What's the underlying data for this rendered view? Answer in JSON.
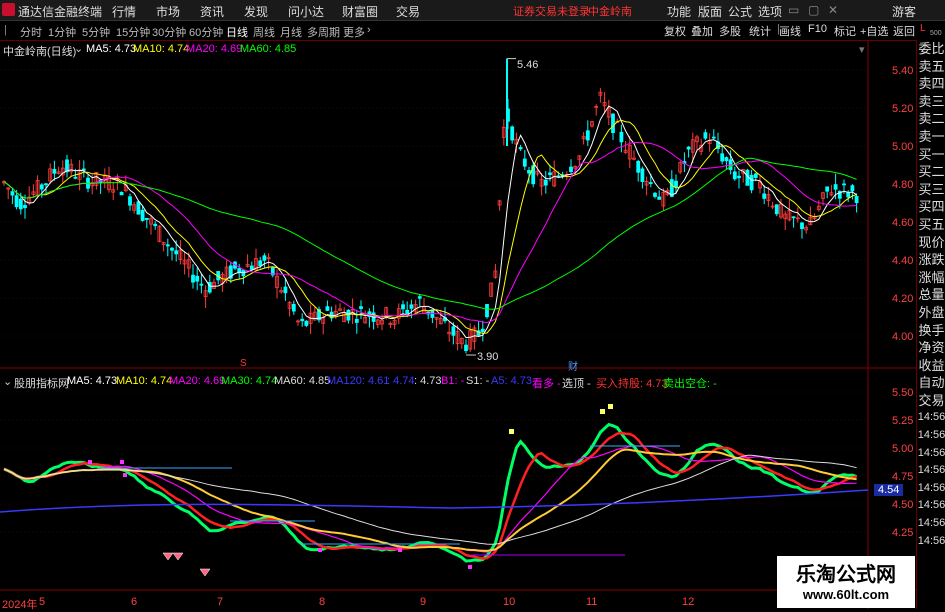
{
  "menubar": {
    "app_title": "通达信金融终端",
    "items": [
      "行情",
      "市场",
      "资讯",
      "发现",
      "问小达",
      "财富圈",
      "交易"
    ],
    "notice": "证券交易未登录",
    "notice_stock": "中金岭南",
    "right_items": [
      "功能",
      "版面",
      "公式",
      "选项"
    ],
    "user": "游客"
  },
  "toolbar": {
    "periods": [
      "分时",
      "1分钟",
      "5分钟",
      "15分钟",
      "30分钟",
      "60分钟",
      "日线",
      "周线",
      "月线",
      "多周期",
      "更多"
    ],
    "active": "日线",
    "right_buttons": [
      "复权",
      "叠加",
      "多股",
      "统计",
      "画线",
      "F10",
      "标记",
      "+自选",
      "返回"
    ],
    "l_label": "L",
    "l_sub": "500"
  },
  "main": {
    "stock": "中金岭南(日线)",
    "ma5": "MA5: 4.73",
    "ma10": "MA10: 4.74",
    "ma20": "MA20: 4.69",
    "ma60": "MA60: 4.85",
    "high_label": "5.46",
    "low_label": "3.90",
    "marker_s": "S",
    "marker_cai": "财",
    "price_ticks": [
      "5.40",
      "5.20",
      "5.00",
      "4.80",
      "4.60",
      "4.40",
      "4.20",
      "4.00"
    ]
  },
  "sub": {
    "title": "股朋指标网",
    "ma5": "MA5: 4.73",
    "ma10": "MA10: 4.74",
    "ma20": "MA20: 4.69",
    "ma30": "MA30: 4.74",
    "ma60": "MA60: 4.85",
    "ma120": "MA120: 4.61",
    "v1": ": 4.74",
    "v2": ": 4.73",
    "b1": "B1: -",
    "s1": "S1: -",
    "a5": "A5: 4.73",
    "kanduo": "看多 -",
    "xuanding": "选顶 -",
    "mairu": "买入持股: 4.73",
    "maichu": "卖出空仓: -",
    "ticks": [
      "5.50",
      "5.25",
      "5.00",
      "4.75",
      "4.50",
      "4.25"
    ],
    "cur_price": "4.54"
  },
  "side_labels": [
    "委比",
    "卖五",
    "卖四",
    "卖三",
    "卖二",
    "卖一",
    "买一",
    "买二",
    "买三",
    "买四",
    "买五",
    "现价",
    "涨跌",
    "涨幅",
    "总量",
    "外盘",
    "换手",
    "净资",
    "收益",
    "自动",
    "交易"
  ],
  "side_times": [
    "14:56",
    "14:56",
    "14:56",
    "14:56",
    "14:56",
    "14:56",
    "14:56",
    "14:56"
  ],
  "xaxis": {
    "year": "2024年",
    "months": [
      "5",
      "6",
      "7",
      "8",
      "9",
      "10",
      "11",
      "12"
    ]
  },
  "watermark": {
    "cn": "乐淘公式网",
    "url": "www.60lt.com"
  },
  "colors": {
    "up": "#ff3c3c",
    "down": "#00ffff",
    "ma5": "#ffffff",
    "ma10": "#ffff00",
    "ma20": "#ff00ff",
    "ma60": "#00ff00",
    "ma120": "#3a3aff"
  }
}
